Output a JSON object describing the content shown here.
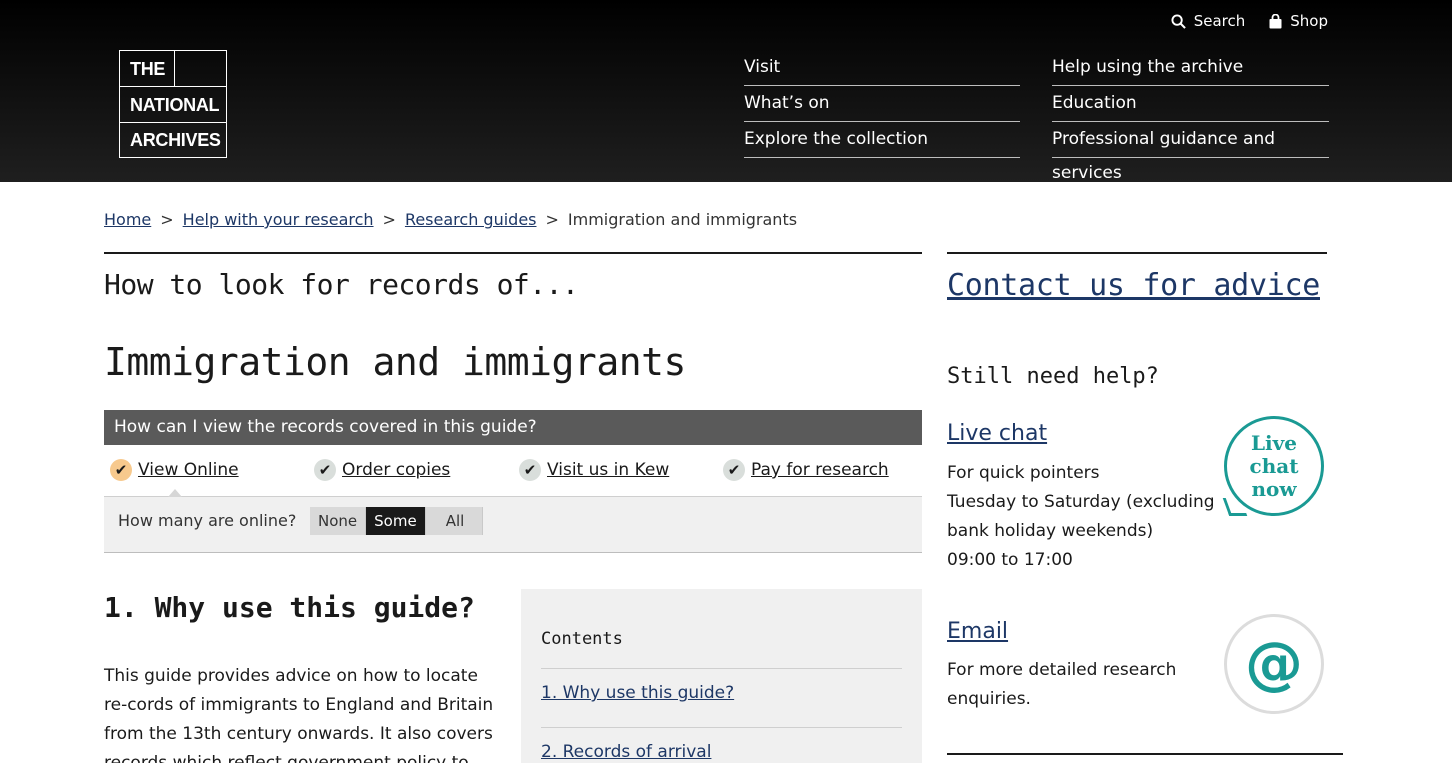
{
  "utility": {
    "search_label": "Search",
    "shop_label": "Shop"
  },
  "logo": {
    "line1": "THE",
    "line2": "NATIONAL",
    "line3": "ARCHIVES"
  },
  "nav": {
    "left": [
      "Visit",
      "What’s on",
      "Explore the collection"
    ],
    "right": [
      "Help using the archive",
      "Education",
      "Professional guidance and services"
    ]
  },
  "breadcrumb": {
    "items": [
      "Home",
      "Help with your research",
      "Research guides"
    ],
    "current": "Immigration and immigrants",
    "separator": ">"
  },
  "main": {
    "kicker": "How to look for records of...",
    "title": "Immigration and immigrants",
    "view_bar": "How can I view the records covered in this guide?",
    "tabs": [
      "View Online",
      "Order copies",
      "Visit us in Kew",
      "Pay for research"
    ],
    "online": {
      "label": "How many are online?",
      "options": [
        "None",
        "Some",
        "All"
      ],
      "selected": "Some"
    },
    "section_title": "1. Why use this guide?",
    "section_text": "This guide provides advice on how to locate re-cords of immigrants to England and Britain from the 13th century onwards. It also covers records which reflect government policy to"
  },
  "contents": {
    "title": "Contents",
    "items": [
      "1. Why use this guide?",
      "2. Records of arrival"
    ]
  },
  "sidebar": {
    "contact": "Contact us for advice",
    "still_need_help": "Still need help?",
    "live_chat": {
      "title": "Live chat",
      "line1": "For quick pointers",
      "line2": "Tuesday to Saturday (excluding bank holiday weekends)",
      "line3": "09:00 to 17:00",
      "badge": [
        "Live",
        "chat",
        "now"
      ]
    },
    "email": {
      "title": "Email",
      "text": "For more detailed research enquiries.",
      "badge": "@"
    }
  },
  "colors": {
    "header_bg": "#000000",
    "link": "#1d3766",
    "accent_teal": "#1a9a94",
    "active_check": "#f7c98d"
  }
}
